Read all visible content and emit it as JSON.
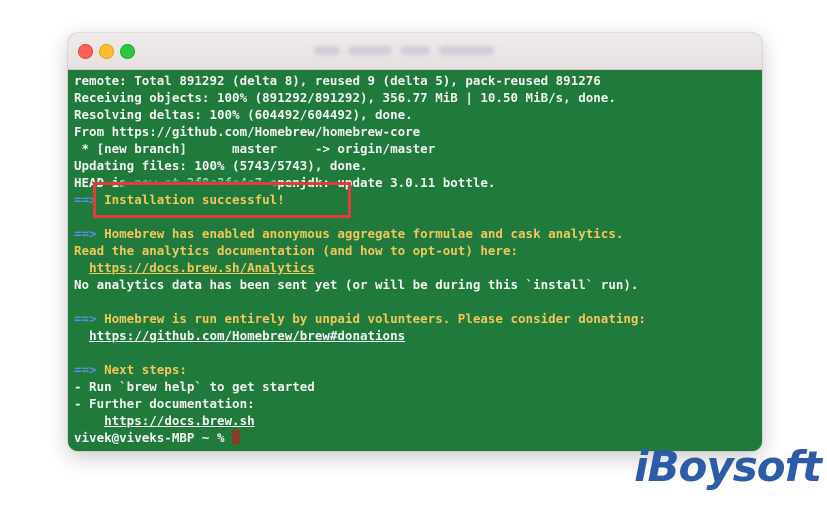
{
  "window": {
    "title_obscured": true
  },
  "terminal": {
    "lines": [
      {
        "parts": [
          {
            "text": "remote: Total 891292 (delta 8), reused 9 (delta 5), pack-reused 891276",
            "style": "white"
          }
        ]
      },
      {
        "parts": [
          {
            "text": "Receiving objects: 100% (891292/891292), 356.77 MiB | 10.50 MiB/s, done.",
            "style": "white"
          }
        ]
      },
      {
        "parts": [
          {
            "text": "Resolving deltas: 100% (604492/604492), done.",
            "style": "white"
          }
        ]
      },
      {
        "parts": [
          {
            "text": "From https://github.com/Homebrew/homebrew-core",
            "style": "white"
          }
        ]
      },
      {
        "parts": [
          {
            "text": " * [new branch]      master     -> origin/master",
            "style": "white"
          }
        ]
      },
      {
        "parts": [
          {
            "text": "Updating files: 100% (5743/5743), done.",
            "style": "white"
          }
        ]
      },
      {
        "parts": [
          {
            "text": "HEAD is now at 2f8c3fe4e7 openjdk: update 3.0.11 bottle.",
            "style": "white"
          }
        ]
      },
      {
        "parts": [
          {
            "text": "==>",
            "style": "arrow"
          },
          {
            "text": " Installation successful!",
            "style": "yellow"
          }
        ]
      },
      {
        "parts": [
          {
            "text": "",
            "style": "white"
          }
        ]
      },
      {
        "parts": [
          {
            "text": "==>",
            "style": "arrow"
          },
          {
            "text": " Homebrew has enabled anonymous aggregate formulae and cask analytics.",
            "style": "yellow"
          }
        ]
      },
      {
        "parts": [
          {
            "text": "Read the analytics documentation (and how to opt-out) here:",
            "style": "yellow"
          }
        ]
      },
      {
        "parts": [
          {
            "text": "  ",
            "style": "white"
          },
          {
            "text": "https://docs.brew.sh/Analytics",
            "style": "link"
          }
        ]
      },
      {
        "parts": [
          {
            "text": "No analytics data has been sent yet (or will be during this `install` run).",
            "style": "white"
          }
        ]
      },
      {
        "parts": [
          {
            "text": "",
            "style": "white"
          }
        ]
      },
      {
        "parts": [
          {
            "text": "==>",
            "style": "arrow"
          },
          {
            "text": " Homebrew is run entirely by unpaid volunteers. Please consider donating:",
            "style": "yellow"
          }
        ]
      },
      {
        "parts": [
          {
            "text": "  ",
            "style": "white"
          },
          {
            "text": "https://github.com/Homebrew/brew#donations",
            "style": "link-white"
          }
        ]
      },
      {
        "parts": [
          {
            "text": "",
            "style": "white"
          }
        ]
      },
      {
        "parts": [
          {
            "text": "==>",
            "style": "arrow"
          },
          {
            "text": " Next steps:",
            "style": "yellow"
          }
        ]
      },
      {
        "parts": [
          {
            "text": "- Run `brew help` to get started",
            "style": "white"
          }
        ]
      },
      {
        "parts": [
          {
            "text": "- Further documentation:",
            "style": "white"
          }
        ]
      },
      {
        "parts": [
          {
            "text": "    ",
            "style": "white"
          },
          {
            "text": "https://docs.brew.sh",
            "style": "link-white"
          }
        ]
      },
      {
        "parts": [
          {
            "text": "vivek@viveks-MBP ~ % ",
            "style": "white"
          }
        ]
      }
    ]
  },
  "watermark": {
    "text": "iBoysoft"
  },
  "colors": {
    "terminal_bg": "#1f7a3c",
    "highlight_border": "#e23c3a",
    "yellow_text": "#f2c85a",
    "arrow": "#5b8ee8",
    "watermark": "#2c5ba8"
  }
}
